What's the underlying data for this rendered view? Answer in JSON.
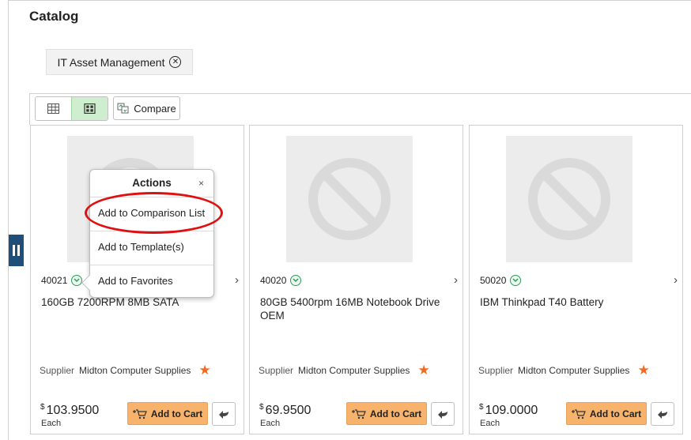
{
  "page": {
    "title": "Catalog"
  },
  "filter": {
    "label": "IT Asset Management",
    "close_glyph": "✕"
  },
  "toolbar": {
    "compare_label": "Compare"
  },
  "products": [
    {
      "item_no": "40021",
      "name": "160GB 7200RPM 8MB SATA",
      "supplier_label": "Supplier",
      "supplier": "Midton Computer Supplies",
      "currency": "$",
      "price": "103.9500",
      "unit": "Each",
      "cart_label": "Add to Cart"
    },
    {
      "item_no": "40020",
      "name": "80GB 5400rpm 16MB Notebook Drive OEM",
      "supplier_label": "Supplier",
      "supplier": "Midton Computer Supplies",
      "currency": "$",
      "price": "69.9500",
      "unit": "Each",
      "cart_label": "Add to Cart"
    },
    {
      "item_no": "50020",
      "name": "IBM Thinkpad T40 Battery",
      "supplier_label": "Supplier",
      "supplier": "Midton Computer Supplies",
      "currency": "$",
      "price": "109.0000",
      "unit": "Each",
      "cart_label": "Add to Cart"
    }
  ],
  "actions_popup": {
    "title": "Actions",
    "close_glyph": "×",
    "items": [
      "Add to Comparison List",
      "Add to Template(s)",
      "Add to Favorites"
    ]
  },
  "colors": {
    "accent_green": "#2d9b5a",
    "cart_button": "#f7b36b",
    "star": "#f26a21",
    "highlight": "#e01010",
    "side_handle": "#1f4e79"
  }
}
